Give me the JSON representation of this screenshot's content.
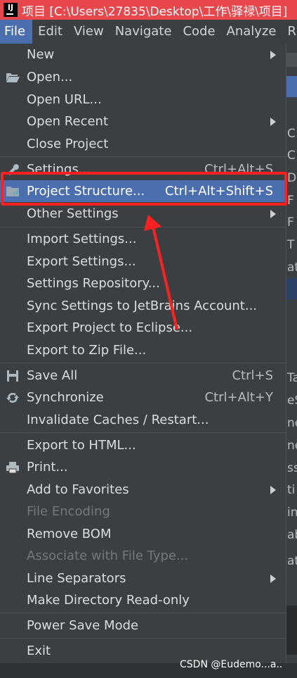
{
  "window": {
    "title": "项目 [C:\\Users\\27835\\Desktop\\工作\\驿禄\\项目]",
    "app_icon_text": "IJ"
  },
  "menubar": [
    "File",
    "Edit",
    "View",
    "Navigate",
    "Code",
    "Analyze"
  ],
  "menubar_overflow": "R",
  "file_menu": {
    "new": "New",
    "open": "Open...",
    "open_url": "Open URL...",
    "open_recent": "Open Recent",
    "close_project": "Close Project",
    "settings": "Settings...",
    "settings_shortcut": "Ctrl+Alt+S",
    "project_structure": "Project Structure...",
    "project_structure_shortcut": "Ctrl+Alt+Shift+S",
    "other_settings": "Other Settings",
    "import_settings": "Import Settings...",
    "export_settings": "Export Settings...",
    "settings_repository": "Settings Repository...",
    "sync_settings": "Sync Settings to JetBrains Account...",
    "export_eclipse": "Export Project to Eclipse...",
    "export_zip": "Export to Zip File...",
    "save_all": "Save All",
    "save_all_shortcut": "Ctrl+S",
    "synchronize": "Synchronize",
    "synchronize_shortcut": "Ctrl+Alt+Y",
    "invalidate_caches": "Invalidate Caches / Restart...",
    "export_html": "Export to HTML...",
    "print": "Print...",
    "add_favorites": "Add to Favorites",
    "file_encoding": "File Encoding",
    "remove_bom": "Remove BOM",
    "associate_file_type": "Associate with File Type...",
    "line_separators": "Line Separators",
    "make_readonly": "Make Directory Read-only",
    "power_save": "Power Save Mode",
    "exit": "Exit"
  },
  "background_fragments": [
    "C",
    "C",
    "D",
    "F",
    "F",
    "T",
    "at",
    "Ta",
    "eS",
    "ne",
    "ne",
    "ss",
    "ti",
    "in",
    "ab",
    "at"
  ],
  "watermark": "CSDN @Eudemo...a..",
  "colors": {
    "titlebar": "#e8474c",
    "selection": "#4b6eaf",
    "menu_bg": "#3c3f41",
    "annotation": "#ff2020"
  }
}
